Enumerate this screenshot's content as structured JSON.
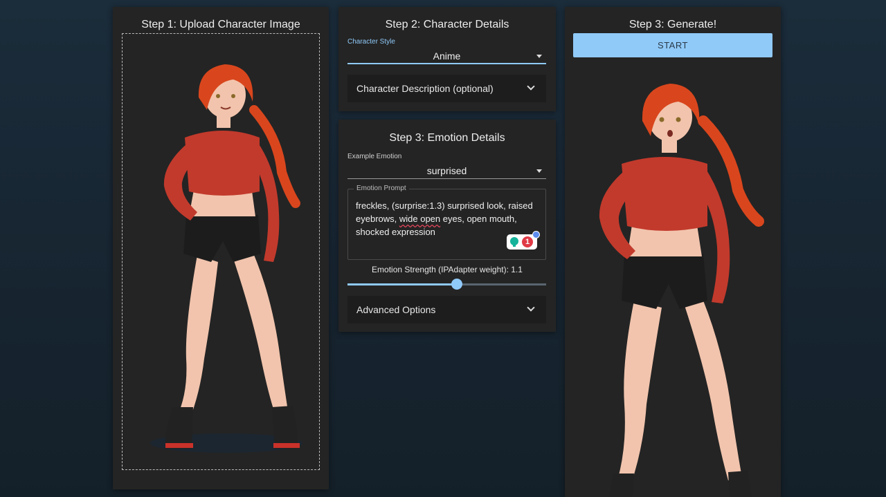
{
  "colors": {
    "accent": "#90caf9",
    "panel": "#242424",
    "accordion": "#1d1d1d",
    "hair": "#d9461d",
    "jacket": "#c23a2c",
    "shorts": "#1c1c1c",
    "skin": "#f2c4ad"
  },
  "step1": {
    "title": "Step 1: Upload Character Image"
  },
  "step2": {
    "title": "Step 2: Character Details",
    "style_label": "Character Style",
    "style_value": "Anime",
    "description_accordion": "Character Description (optional)"
  },
  "step3": {
    "title": "Step 3: Emotion Details",
    "emotion_label": "Example Emotion",
    "emotion_value": "surprised",
    "prompt_label": "Emotion Prompt",
    "prompt_before": "freckles, (surprise:1.3) surprised look, raised eyebrows, ",
    "prompt_flagged": "wide open",
    "prompt_after": " eyes, open mouth, shocked expression",
    "extension_badge_count": "1",
    "strength_label": "Emotion Strength (IPAdapter weight): 1.1",
    "strength_fraction": 0.55,
    "advanced_accordion": "Advanced Options"
  },
  "generate": {
    "title": "Step 3: Generate!",
    "start_label": "START"
  },
  "icons": {
    "select_caret": "caret-down-icon",
    "accordion_chevron": "chevron-down-icon",
    "extension": "grammar-extension-icon"
  }
}
